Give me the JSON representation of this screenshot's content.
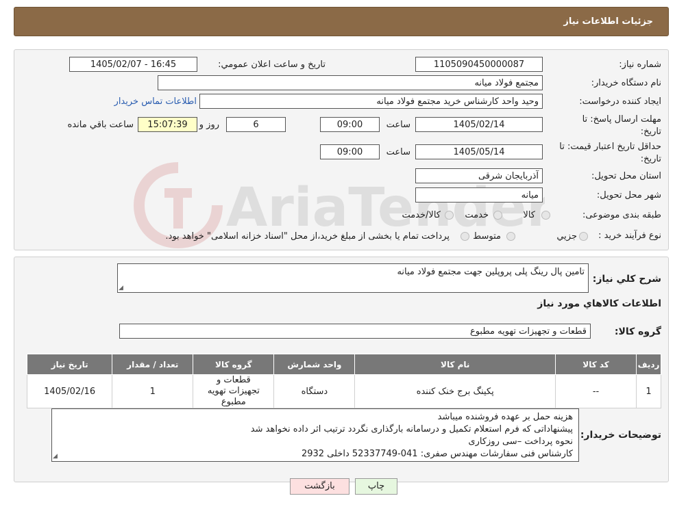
{
  "header": {
    "title": "جزئیات اطلاعات نیاز"
  },
  "form": {
    "need_number_label": "شماره نیاز:",
    "need_number": "1105090450000087",
    "announce_label": "تاریخ و ساعت اعلان عمومي:",
    "announce_value": "1405/02/07 - 16:45",
    "buyer_label": "نام دستگاه خريدار:",
    "buyer_value": "مجتمع فولاد میانه",
    "creator_label": "ايجاد کننده درخواست:",
    "creator_value": "وحید واحد کارشناس خرید مجتمع فولاد میانه",
    "contact_link": "اطلاعات تماس خريدار",
    "deadline_label_1": "مهلت ارسال پاسخ: تا",
    "deadline_label_2": "تاریخ:",
    "deadline_date": "1405/02/14",
    "time_label": "ساعت",
    "deadline_time": "09:00",
    "deadline_days": "6",
    "days_label": "روز و",
    "remaining_time": "15:07:39",
    "remaining_label": "ساعت باقي مانده",
    "validity_label_1": "حداقل تاريخ اعتبار قيمت: تا",
    "validity_label_2": "تاریخ:",
    "validity_date": "1405/05/14",
    "validity_time": "09:00",
    "province_label": "استان محل تحويل:",
    "province_value": "آذربایجان شرقی",
    "city_label": "شهر محل تحويل:",
    "city_value": "میانه",
    "category_label": "طبقه بندی موضوعی:",
    "category_options": [
      "کالا",
      "خدمت",
      "کالا/خدمت"
    ],
    "process_label": "نوع فرآيند خريد :",
    "process_options": [
      "جزيي",
      "متوسط"
    ],
    "process_note": "پرداخت تمام یا بخشی از مبلغ خرید،از محل \"اسناد خزانه اسلامی\" خواهد بود."
  },
  "summary": {
    "label": "شرح كلي نياز:",
    "value": "تامین پال رینگ پلی پروپلین جهت مجتمع فولاد میانه"
  },
  "goods": {
    "section_title": "اطلاعات كالاهاي مورد نياز",
    "group_label": "گروه كالا:",
    "group_value": "قطعات و تجهیزات تهویه مطبوع",
    "columns": [
      "رديف",
      "كد كالا",
      "نام كالا",
      "واحد شمارش",
      "گروه كالا",
      "تعداد / مقدار",
      "تاريخ نياز"
    ],
    "rows": [
      [
        "1",
        "--",
        "پکینگ برج خنک کننده",
        "دستگاه",
        "قطعات و تجهیزات تهویه مطبوع",
        "1",
        "1405/02/16"
      ]
    ]
  },
  "buyer_notes": {
    "label": "توضيحات خريدار:",
    "lines": [
      "هزینه حمل بر عهده فروشنده میباشد",
      "پیشنهاداتی که فرم استعلام تکمیل و درسامانه بارگذاری نگردد ترتیب اثر داده نخواهد شد",
      "نحوه پرداخت –سی روزکاری",
      "کارشناس فنی سفارشات مهندس صفری:  041-52337749  داخلی 2932"
    ]
  },
  "buttons": {
    "print": "چاپ",
    "back": "بازگشت"
  },
  "watermark": {
    "text": "AriaTender.neT"
  },
  "colors": {
    "header": "#8B6A47",
    "table_header": "#787878",
    "back_button": "#fde0e0",
    "print_button": "#e6f7df",
    "remaining_bg": "#ffffc8"
  }
}
